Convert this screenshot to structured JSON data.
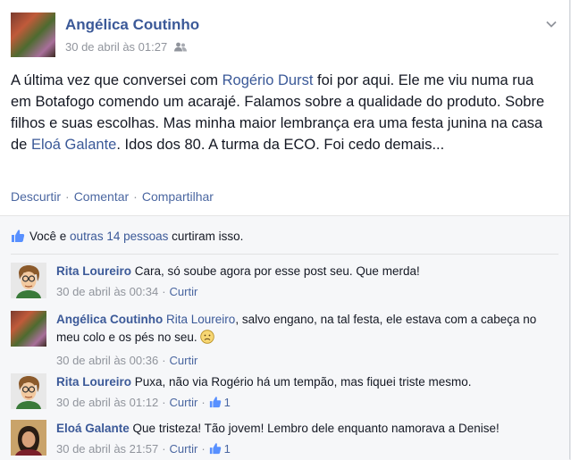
{
  "post": {
    "author": "Angélica Coutinho",
    "timestamp": "30 de abril às 01:27",
    "audience_icon": "friends-icon",
    "text_parts": {
      "p1": "A última vez que conversei com ",
      "link1": "Rogério Durst",
      "p2": " foi por aqui. Ele me viu numa rua em Botafogo comendo um acarajé. Falamos sobre a qualidade do produto. Sobre filhos e suas escolhas. Mas minha maior lembrança era uma festa junina na casa de ",
      "link2": "Eloá Galante",
      "p3": ". Idos dos 80. A turma da ECO. Foi cedo demais..."
    },
    "actions": [
      "Descurtir",
      "Comentar",
      "Compartilhar"
    ]
  },
  "likes": {
    "prefix": "Você e ",
    "link": "outras 14 pessoas",
    "suffix": " curtiram isso."
  },
  "comments": [
    {
      "author": "Rita Loureiro",
      "text": "Cara, só soube agora por esse post seu. Que merda!",
      "timestamp": "30 de abril às 00:34",
      "action": "Curtir",
      "like_count": ""
    },
    {
      "author": "Angélica Coutinho",
      "mention": "Rita Loureiro",
      "text": ", salvo engano, na tal festa, ele estava com a cabeça no meu colo e os pés no seu.",
      "emoticon": "sad-face-icon",
      "timestamp": "30 de abril às 00:36",
      "action": "Curtir",
      "like_count": ""
    },
    {
      "author": "Rita Loureiro",
      "text": "Puxa, não via Rogério há um tempão, mas fiquei triste mesmo.",
      "timestamp": "30 de abril às 01:12",
      "action": "Curtir",
      "like_count": "1"
    },
    {
      "author": "Eloá Galante",
      "text": "Que tristeza! Tão jovem! Lembro dele enquanto namorava a Denise!",
      "timestamp": "30 de abril às 21:57",
      "action": "Curtir",
      "like_count": "1"
    }
  ],
  "colors": {
    "link": "#3b5998",
    "meta": "#90949c",
    "ufi_bg": "#f6f7f9"
  }
}
